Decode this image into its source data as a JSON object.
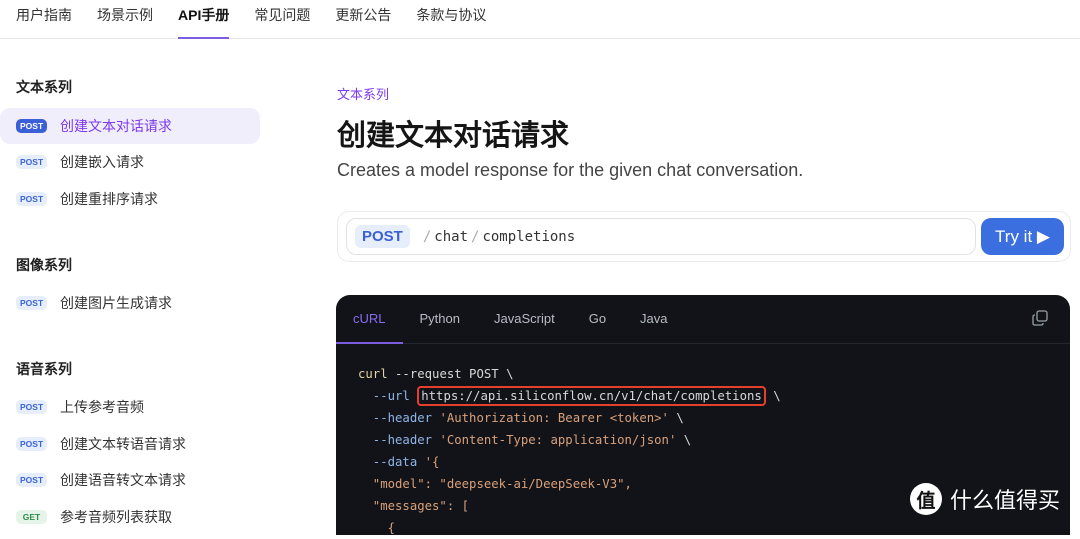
{
  "topnav": [
    "用户指南",
    "场景示例",
    "API手册",
    "常见问题",
    "更新公告",
    "条款与协议"
  ],
  "sidebar": {
    "sections": [
      "文本系列",
      "图像系列",
      "语音系列"
    ],
    "items": [
      {
        "method": "POST",
        "label": "创建文本对话请求"
      },
      {
        "method": "POST",
        "label": "创建嵌入请求"
      },
      {
        "method": "POST",
        "label": "创建重排序请求"
      },
      {
        "method": "POST",
        "label": "创建图片生成请求"
      },
      {
        "method": "POST",
        "label": "上传参考音频"
      },
      {
        "method": "POST",
        "label": "创建文本转语音请求"
      },
      {
        "method": "POST",
        "label": "创建语音转文本请求"
      },
      {
        "method": "GET",
        "label": "参考音频列表获取"
      }
    ]
  },
  "main": {
    "category": "文本系列",
    "title": "创建文本对话请求",
    "description": "Creates a model response for the given chat conversation.",
    "endpoint": {
      "method": "POST",
      "seg1": "chat",
      "seg2": "completions",
      "try_label": "Try it ▶"
    },
    "code": {
      "tabs": [
        "cURL",
        "Python",
        "JavaScript",
        "Go",
        "Java"
      ],
      "lines": {
        "l1a": "curl",
        "l1b": " --request POST \\",
        "l2a": "  --url ",
        "l2b": "https://api.siliconflow.cn/v1/chat/completions",
        "l2c": " \\",
        "l3a": "  --header ",
        "l3b": "'Authorization: Bearer <token>'",
        "l3c": " \\",
        "l4a": "  --header ",
        "l4b": "'Content-Type: application/json'",
        "l4c": " \\",
        "l5a": "  --data ",
        "l5b": "'{",
        "l6": "  \"model\": \"deepseek-ai/DeepSeek-V3\",",
        "l7": "  \"messages\": [",
        "l8": "    {"
      }
    }
  },
  "watermark": {
    "icon": "值",
    "text": "什么值得买"
  }
}
